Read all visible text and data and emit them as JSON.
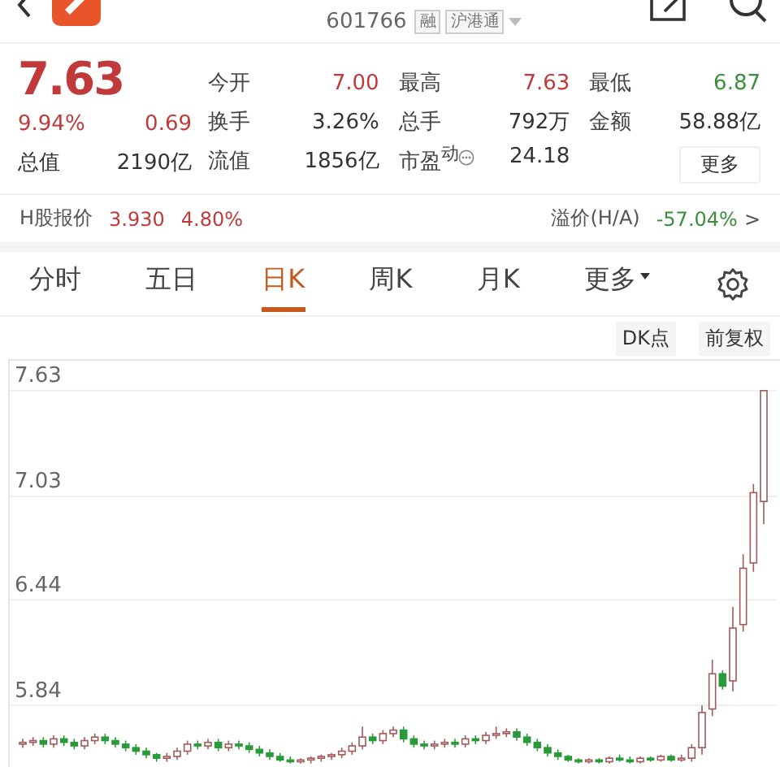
{
  "header": {
    "code": "601766",
    "tags": [
      "融",
      "沪港通"
    ]
  },
  "quote": {
    "price": "7.63",
    "change_pct": "9.94%",
    "change": "0.69",
    "color": "#c0393b",
    "stats": [
      {
        "label": "今开",
        "value": "7.00",
        "color": "#c0393b"
      },
      {
        "label": "最高",
        "value": "7.63",
        "color": "#c0393b"
      },
      {
        "label": "最低",
        "value": "6.87",
        "color": "#3b8f3b"
      },
      {
        "label": "换手",
        "value": "3.26%"
      },
      {
        "label": "总手",
        "value": "792万"
      },
      {
        "label": "金额",
        "value": "58.88亿"
      },
      {
        "label": "总值",
        "value": "2190亿"
      },
      {
        "label": "流值",
        "value": "1856亿"
      },
      {
        "label": "市盈$^{动}$",
        "value": "24.18",
        "info": true
      }
    ],
    "more_button": "更多"
  },
  "h_share": {
    "label": "H股报价",
    "price": "3.930",
    "change_pct": "4.80%",
    "color": "#c0393b",
    "premium": {
      "label": "溢价(H/A)",
      "value": "-57.04%",
      "color": "#3b8f3b"
    },
    "arrow": ">"
  },
  "tabs": [
    {
      "label": "分时",
      "selected": false
    },
    {
      "label": "五日",
      "selected": false
    },
    {
      "label": "日K",
      "selected": true
    },
    {
      "label": "周K",
      "selected": false
    },
    {
      "label": "月K",
      "selected": false
    },
    {
      "label": "更多",
      "selected": false,
      "kind": "menu"
    }
  ],
  "chart": {
    "buttons": [
      "DK点",
      "前复权"
    ],
    "chart_data": {
      "type": "candlestick",
      "grid": true,
      "ylim": [
        5.49,
        7.8
      ],
      "yticks": [
        7.63,
        7.03,
        6.44,
        5.84
      ],
      "ohlc": [
        [
          5.62,
          5.65,
          5.6,
          5.63
        ],
        [
          5.63,
          5.66,
          5.61,
          5.64
        ],
        [
          5.64,
          5.66,
          5.6,
          5.62
        ],
        [
          5.62,
          5.67,
          5.6,
          5.65
        ],
        [
          5.65,
          5.67,
          5.61,
          5.63
        ],
        [
          5.63,
          5.65,
          5.59,
          5.61
        ],
        [
          5.61,
          5.66,
          5.59,
          5.64
        ],
        [
          5.64,
          5.68,
          5.62,
          5.66
        ],
        [
          5.66,
          5.68,
          5.62,
          5.64
        ],
        [
          5.64,
          5.66,
          5.6,
          5.62
        ],
        [
          5.62,
          5.64,
          5.58,
          5.6
        ],
        [
          5.6,
          5.62,
          5.56,
          5.58
        ],
        [
          5.58,
          5.6,
          5.54,
          5.56
        ],
        [
          5.56,
          5.57,
          5.52,
          5.54
        ],
        [
          5.54,
          5.57,
          5.52,
          5.55
        ],
        [
          5.55,
          5.6,
          5.53,
          5.58
        ],
        [
          5.58,
          5.64,
          5.56,
          5.62
        ],
        [
          5.62,
          5.64,
          5.59,
          5.61
        ],
        [
          5.61,
          5.65,
          5.59,
          5.63
        ],
        [
          5.63,
          5.65,
          5.58,
          5.6
        ],
        [
          5.6,
          5.64,
          5.58,
          5.62
        ],
        [
          5.62,
          5.64,
          5.59,
          5.61
        ],
        [
          5.61,
          5.63,
          5.57,
          5.59
        ],
        [
          5.59,
          5.61,
          5.55,
          5.57
        ],
        [
          5.57,
          5.59,
          5.53,
          5.55
        ],
        [
          5.55,
          5.57,
          5.52,
          5.53
        ],
        [
          5.53,
          5.55,
          5.51,
          5.52
        ],
        [
          5.52,
          5.54,
          5.51,
          5.53
        ],
        [
          5.53,
          5.55,
          5.51,
          5.54
        ],
        [
          5.54,
          5.56,
          5.52,
          5.55
        ],
        [
          5.55,
          5.57,
          5.53,
          5.56
        ],
        [
          5.56,
          5.6,
          5.54,
          5.58
        ],
        [
          5.58,
          5.63,
          5.56,
          5.61
        ],
        [
          5.61,
          5.72,
          5.59,
          5.66
        ],
        [
          5.66,
          5.68,
          5.62,
          5.64
        ],
        [
          5.64,
          5.7,
          5.62,
          5.68
        ],
        [
          5.68,
          5.72,
          5.66,
          5.7
        ],
        [
          5.7,
          5.72,
          5.63,
          5.65
        ],
        [
          5.65,
          5.67,
          5.6,
          5.62
        ],
        [
          5.62,
          5.64,
          5.59,
          5.61
        ],
        [
          5.61,
          5.64,
          5.59,
          5.62
        ],
        [
          5.62,
          5.65,
          5.6,
          5.63
        ],
        [
          5.63,
          5.65,
          5.6,
          5.62
        ],
        [
          5.62,
          5.67,
          5.6,
          5.65
        ],
        [
          5.65,
          5.67,
          5.62,
          5.64
        ],
        [
          5.64,
          5.69,
          5.62,
          5.67
        ],
        [
          5.67,
          5.72,
          5.65,
          5.68
        ],
        [
          5.68,
          5.71,
          5.66,
          5.69
        ],
        [
          5.69,
          5.71,
          5.64,
          5.66
        ],
        [
          5.66,
          5.68,
          5.61,
          5.63
        ],
        [
          5.63,
          5.65,
          5.58,
          5.6
        ],
        [
          5.6,
          5.62,
          5.55,
          5.57
        ],
        [
          5.57,
          5.59,
          5.53,
          5.55
        ],
        [
          5.55,
          5.56,
          5.52,
          5.53
        ],
        [
          5.53,
          5.54,
          5.51,
          5.52
        ],
        [
          5.52,
          5.54,
          5.51,
          5.53
        ],
        [
          5.53,
          5.54,
          5.51,
          5.52
        ],
        [
          5.52,
          5.55,
          5.51,
          5.54
        ],
        [
          5.54,
          5.56,
          5.52,
          5.53
        ],
        [
          5.53,
          5.55,
          5.51,
          5.52
        ],
        [
          5.52,
          5.55,
          5.51,
          5.54
        ],
        [
          5.54,
          5.55,
          5.52,
          5.53
        ],
        [
          5.53,
          5.56,
          5.52,
          5.55
        ],
        [
          5.55,
          5.56,
          5.52,
          5.53
        ],
        [
          5.53,
          5.56,
          5.52,
          5.54
        ],
        [
          5.54,
          5.62,
          5.52,
          5.6
        ],
        [
          5.6,
          5.84,
          5.56,
          5.8
        ],
        [
          5.82,
          6.1,
          5.78,
          6.02
        ],
        [
          6.02,
          6.04,
          5.93,
          5.95
        ],
        [
          5.98,
          6.4,
          5.92,
          6.28
        ],
        [
          6.3,
          6.7,
          6.26,
          6.62
        ],
        [
          6.65,
          7.1,
          6.6,
          7.05
        ],
        [
          7.0,
          7.63,
          6.87,
          7.63
        ]
      ]
    }
  }
}
